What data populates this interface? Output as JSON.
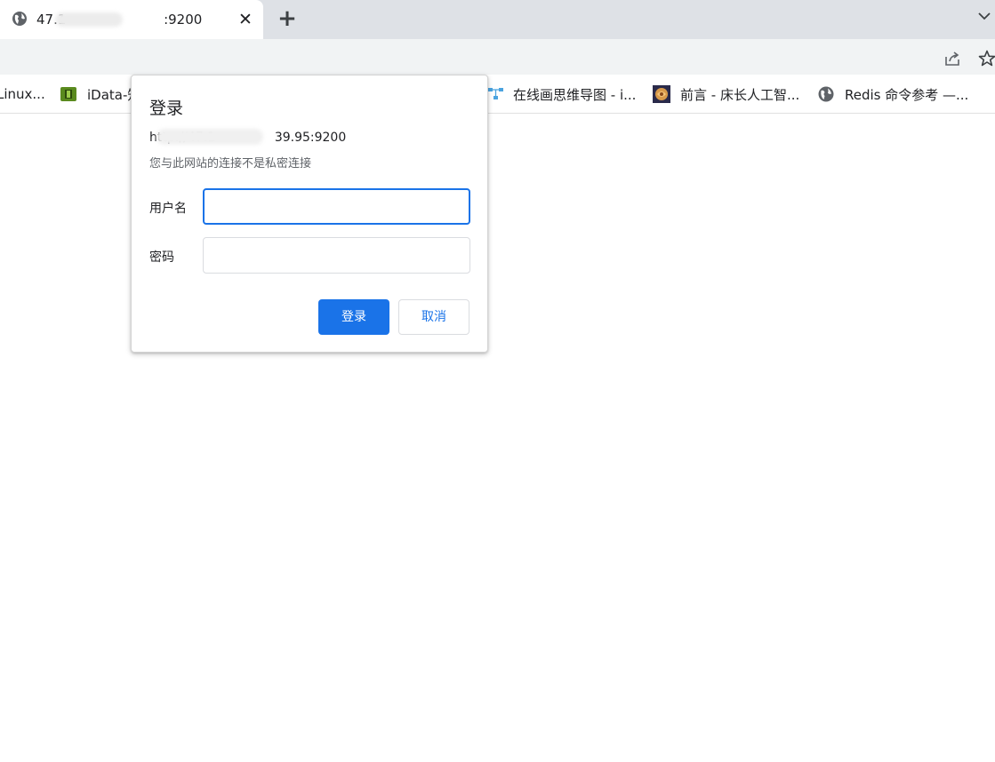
{
  "tab": {
    "title": "47.1                       :9200",
    "favicon": "globe-icon",
    "close_glyph": "✕",
    "new_tab_glyph": "+"
  },
  "toolbar": {
    "icons": [
      "share-icon",
      "bookmark-star-icon"
    ]
  },
  "bookmarks": [
    {
      "label": "Linux...",
      "icon": "none"
    },
    {
      "label": "iData-知",
      "icon": "idata-icon"
    },
    {
      "label": "在线画思维导图 - i...",
      "icon": "mindmap-icon"
    },
    {
      "label": "前言 - 床长人工智...",
      "icon": "brain-icon"
    },
    {
      "label": "Redis 命令参考 —...",
      "icon": "globe-icon"
    }
  ],
  "dialog": {
    "title": "登录",
    "url": "http://47.1               39.95:9200",
    "warning": "您与此网站的连接不是私密连接",
    "username_label": "用户名",
    "username_value": "",
    "password_label": "密码",
    "password_value": "",
    "login_button": "登录",
    "cancel_button": "取消"
  },
  "colors": {
    "accent": "#1a73e8",
    "tabstrip": "#dee1e6",
    "toolbar": "#f1f3f4"
  }
}
